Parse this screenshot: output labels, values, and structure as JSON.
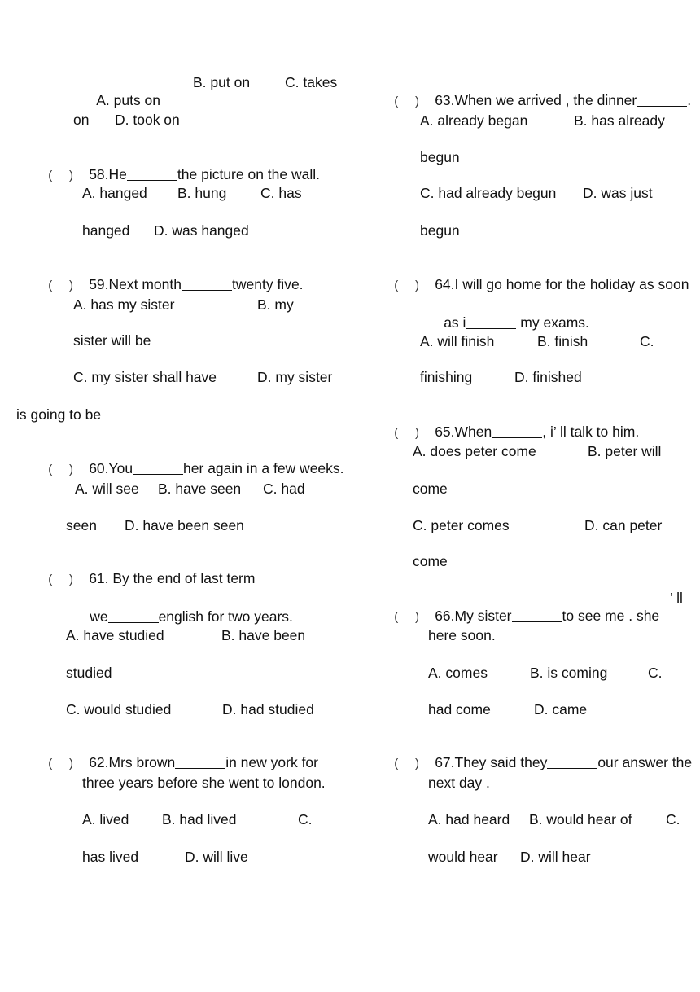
{
  "left_column": {
    "q57_cont": {
      "line1": {
        "a": "A. puts on",
        "b": "B. put on",
        "c": "C. takes"
      },
      "line2": {
        "c_cont": "on",
        "d": "D. took on"
      }
    },
    "q58": {
      "paren_open": "(",
      "paren_close": ")",
      "number_prefix": "58.He",
      "after_blank": "the picture on the wall.",
      "line1": {
        "a": "A. hanged",
        "b": "B. hung",
        "c": "C. has"
      },
      "line2": {
        "c_cont": "hanged",
        "d": "D. was hanged"
      }
    },
    "q59": {
      "paren_open": "(",
      "paren_close": ")",
      "number_prefix": "59.Next month",
      "after_blank": "twenty five.",
      "line1": {
        "a": "A. has my sister",
        "b": "B. my"
      },
      "line2": {
        "b_cont": "sister will be"
      },
      "line3": {
        "c": "C. my sister shall have",
        "d": "D. my sister"
      },
      "line4": {
        "d_cont": "is going to be"
      }
    },
    "q60": {
      "paren_open": "(",
      "paren_close": ")",
      "number_prefix": "60.You",
      "after_blank": "her again in a few weeks.",
      "line1": {
        "a": "A. will see",
        "b": "B. have seen",
        "c": "C. had"
      },
      "line2": {
        "c_cont": "seen",
        "d": "D. have been seen"
      }
    },
    "q61": {
      "paren_open": "(",
      "paren_close": ")",
      "stem1": "61. By the end of last term",
      "stem2_prefix": "we",
      "stem2_after_blank": "english for two years.",
      "line1": {
        "a": "A. have studied",
        "b": "B. have been"
      },
      "line2": {
        "b_cont": "studied"
      },
      "line3": {
        "c": "C. would studied",
        "d": "D. had studied"
      }
    },
    "q62": {
      "paren_open": "(",
      "paren_close": ")",
      "number_prefix": "62.Mrs brown",
      "after_blank": "in new york for",
      "stem2": "three years before she went to london.",
      "line1": {
        "a": "A. lived",
        "b": "B. had lived",
        "c": "C."
      },
      "line2": {
        "c_cont": "has lived",
        "d": "D. will live"
      }
    }
  },
  "right_column": {
    "q63": {
      "paren_open": "(",
      "paren_close": ")",
      "number_prefix": "63.When we arrived , the dinner",
      "after_blank": ".",
      "line1": {
        "a": "A. already began",
        "b": "B. has already"
      },
      "line2": {
        "b_cont": "begun"
      },
      "line3": {
        "c": "C. had already begun",
        "d": "D. was just"
      },
      "line4": {
        "d_cont": "begun"
      }
    },
    "q64": {
      "paren_open": "(",
      "paren_close": ")",
      "stem1": "64.I will go home for the holiday as soon",
      "stem2_prefix": "as i",
      "stem2_after_blank": " my exams.",
      "line1": {
        "a": "A. will finish",
        "b": "B. finish",
        "c": "C."
      },
      "line2": {
        "c_cont": "finishing",
        "d": "D. finished"
      }
    },
    "q65": {
      "paren_open": "(",
      "paren_close": ")",
      "number_prefix": "65.When",
      "after_blank": ", i’ ll talk to him.",
      "line1": {
        "a": "A. does peter come",
        "b": "B. peter will"
      },
      "line2": {
        "b_cont": "come"
      },
      "line3": {
        "c": "C. peter comes",
        "d": "D. can peter"
      },
      "line4": {
        "d_cont": "come"
      }
    },
    "q66": {
      "paren_open": "(",
      "paren_close": ")",
      "number_prefix": "66.My sister",
      "after_blank": "to see me . she",
      "stem_tail": "’ ll",
      "stem2": "here soon.",
      "line1": {
        "a": "A. comes",
        "b": "B. is coming",
        "c": "C."
      },
      "line2": {
        "c_cont": "had come",
        "d": "D. came"
      }
    },
    "q67": {
      "paren_open": "(",
      "paren_close": ")",
      "number_prefix": "67.They said they",
      "after_blank": "our answer the",
      "stem2": "next day .",
      "line1": {
        "a": "A. had heard",
        "b": "B. would hear of",
        "c": "C."
      },
      "line2": {
        "c_cont": "would hear",
        "d": "D. will hear"
      }
    }
  }
}
